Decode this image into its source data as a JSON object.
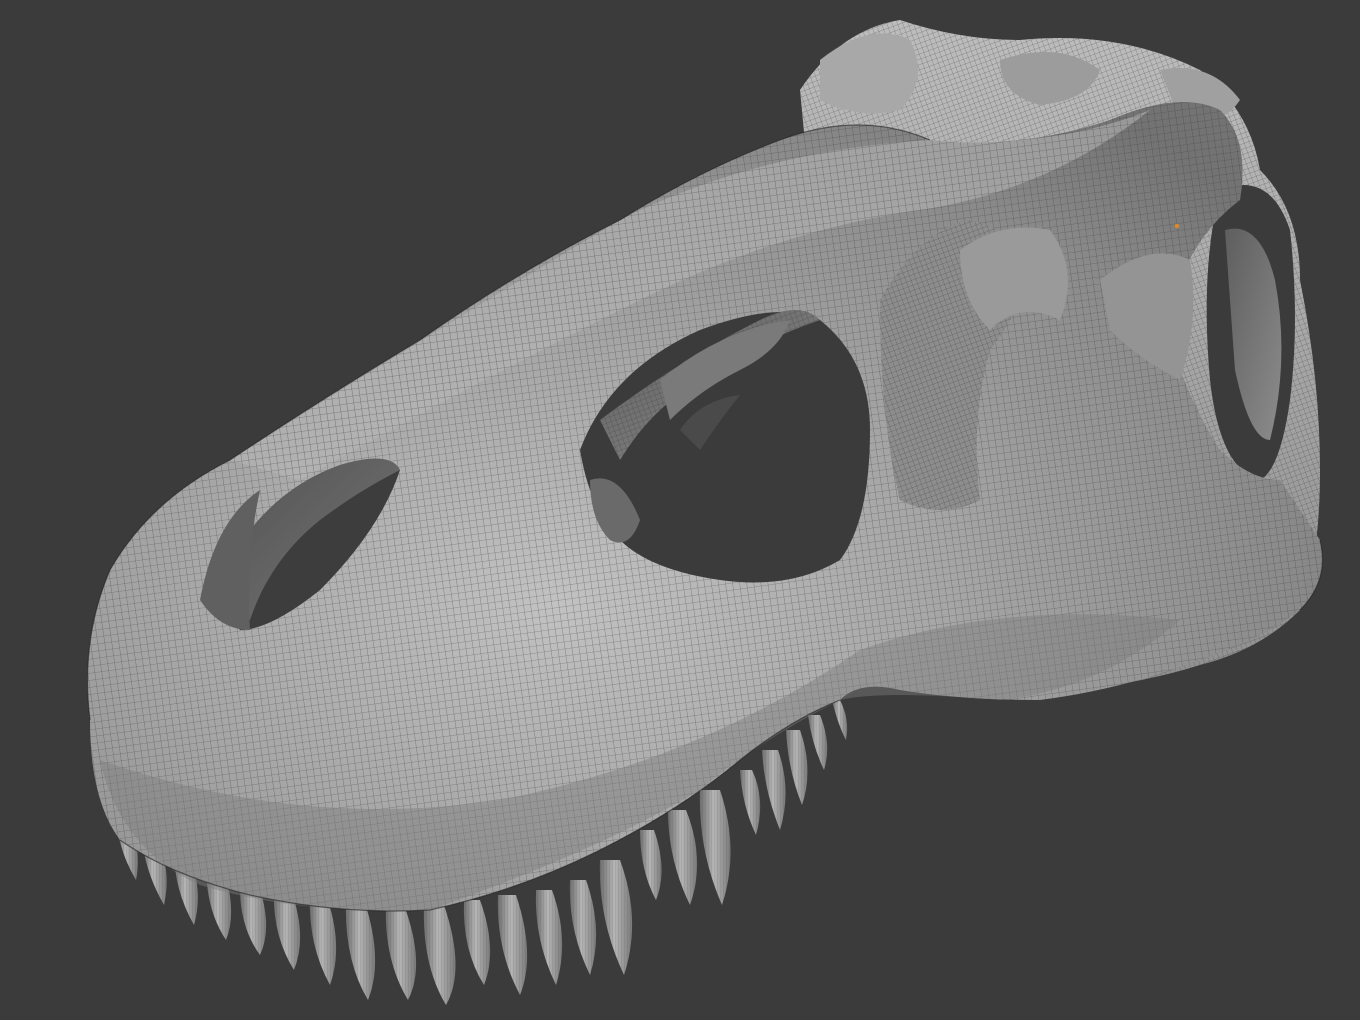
{
  "viewport": {
    "background_color": "#3b3b3b",
    "model": {
      "subject": "skull-mesh",
      "shading": "wireframe-on-solid",
      "surface_color": "#9a9a9a",
      "wire_color": "#2a2a2a"
    },
    "origin_marker_color": "#e08a1e"
  }
}
